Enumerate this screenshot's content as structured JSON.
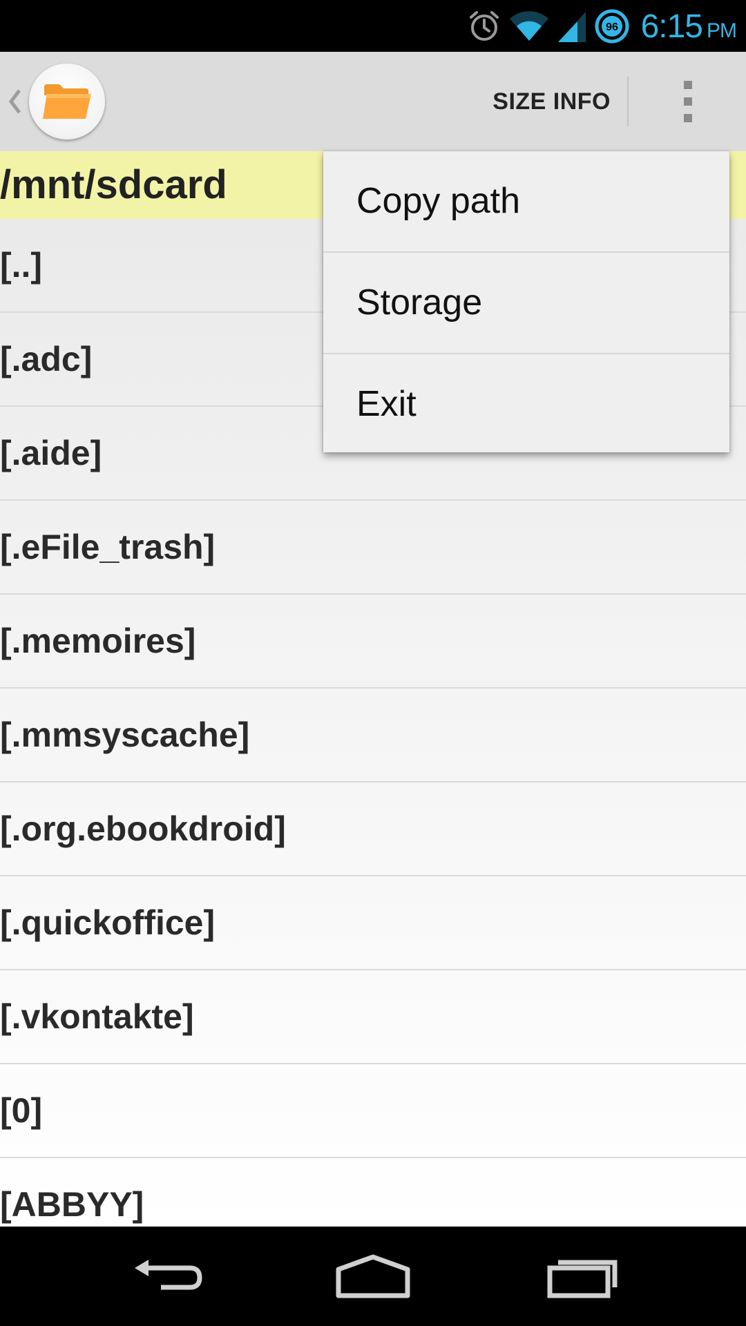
{
  "status_bar": {
    "time": "6:15",
    "ampm": "PM",
    "battery_level": "96",
    "icons": [
      "alarm-icon",
      "wifi-icon",
      "signal-icon",
      "battery-icon"
    ],
    "accent_color": "#33b5e5"
  },
  "action_bar": {
    "size_info_label": "SIZE INFO",
    "app_icon": "folder-icon",
    "overflow_icon": "overflow-menu-icon"
  },
  "path_bar": {
    "path": "/mnt/sdcard",
    "background_color": "#f3f3a7"
  },
  "file_list": {
    "items": [
      "[..]",
      "[.adc]",
      "[.aide]",
      "[.eFile_trash]",
      "[.memoires]",
      "[.mmsyscache]",
      "[.org.ebookdroid]",
      "[.quickoffice]",
      "[.vkontakte]",
      "[0]",
      "[ABBYY]"
    ]
  },
  "popup_menu": {
    "items": [
      "Copy path",
      "Storage",
      "Exit"
    ]
  },
  "nav_bar": {
    "icons": [
      "back-icon",
      "home-icon",
      "recent-apps-icon"
    ]
  }
}
